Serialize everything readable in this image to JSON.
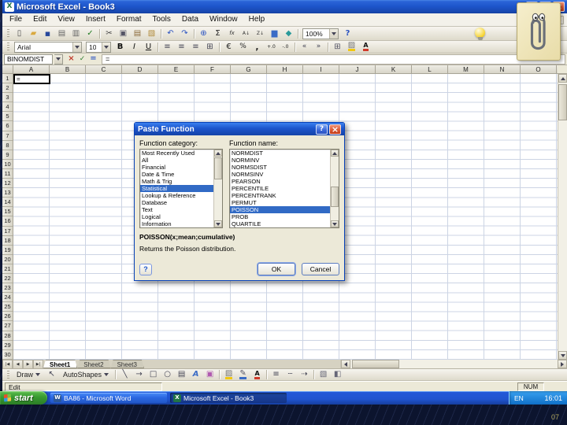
{
  "window": {
    "title": "Microsoft Excel - Book3",
    "app_icons": [
      "excel-app"
    ],
    "control_icons": [
      "minimize",
      "maximize",
      "close"
    ]
  },
  "menu": {
    "items": [
      "File",
      "Edit",
      "View",
      "Insert",
      "Format",
      "Tools",
      "Data",
      "Window",
      "Help"
    ],
    "window_icons": [
      "workbook-minimize",
      "workbook-restore",
      "workbook-close"
    ]
  },
  "standard_toolbar": {
    "icons_left": [
      "new-document",
      "open-folder",
      "save",
      "print",
      "print-preview",
      "spelling",
      "separator",
      "cut",
      "copy",
      "paste",
      "format-painter",
      "separator",
      "undo",
      "redo",
      "separator",
      "insert-hyperlink",
      "autosum",
      "paste-function",
      "sort-ascending",
      "sort-descending",
      "chart-wizard",
      "drawing",
      "separator"
    ],
    "zoom_value": "100%",
    "icons_right": [
      "help"
    ]
  },
  "formatting_toolbar": {
    "font_name": "Arial",
    "font_size": "10",
    "icons": [
      "bold",
      "italic",
      "underline",
      "separator",
      "align-left",
      "align-center",
      "align-right",
      "merge-and-center",
      "separator",
      "currency-style",
      "percent-style",
      "comma-style",
      "increase-decimal",
      "decrease-decimal",
      "separator",
      "decrease-indent",
      "increase-indent",
      "separator",
      "borders",
      "fill-color",
      "font-color"
    ]
  },
  "formula_bar": {
    "name_box": "BINOMDIST",
    "icons": [
      "cancel-formula",
      "enter-formula",
      "edit-formula"
    ],
    "content": "="
  },
  "grid": {
    "columns": [
      "A",
      "B",
      "C",
      "D",
      "E",
      "F",
      "G",
      "H",
      "I",
      "J",
      "K",
      "L",
      "M",
      "N",
      "O"
    ],
    "rows": [
      "1",
      "2",
      "3",
      "4",
      "5",
      "6",
      "7",
      "8",
      "9",
      "10",
      "11",
      "12",
      "13",
      "14",
      "15",
      "16",
      "17",
      "18",
      "19",
      "20",
      "21",
      "22",
      "23",
      "24",
      "25",
      "26",
      "27",
      "28",
      "29",
      "30"
    ],
    "active_cell": "A1",
    "active_cell_value": "="
  },
  "dialog": {
    "title": "Paste Function",
    "control_icons": [
      "dialog-help",
      "dialog-close"
    ],
    "category_label": "Function category:",
    "function_label": "Function name:",
    "categories": [
      "Most Recently Used",
      "All",
      "Financial",
      "Date & Time",
      "Math & Trig",
      "Statistical",
      "Lookup & Reference",
      "Database",
      "Text",
      "Logical",
      "Information"
    ],
    "selected_category": "Statistical",
    "functions": [
      "NORMDIST",
      "NORMINV",
      "NORMSDIST",
      "NORMSINV",
      "PEARSON",
      "PERCENTILE",
      "PERCENTRANK",
      "PERMUT",
      "POISSON",
      "PROB",
      "QUARTILE"
    ],
    "selected_function": "POISSON",
    "signature": "POISSON(x;mean;cumulative)",
    "description": "Returns the Poisson distribution.",
    "help_label": "?",
    "ok_label": "OK",
    "cancel_label": "Cancel"
  },
  "sheet_tabs": {
    "nav_icons": [
      "tab-first",
      "tab-prev",
      "tab-next",
      "tab-last"
    ],
    "tabs": [
      "Sheet1",
      "Sheet2",
      "Sheet3"
    ],
    "active": "Sheet1"
  },
  "drawing_toolbar": {
    "draw_label": "Draw",
    "autoshapes_label": "AutoShapes",
    "icons_pre": [
      "select-object"
    ],
    "icons_post": [
      "separator",
      "line",
      "arrow",
      "rectangle",
      "oval",
      "text-box",
      "wordart",
      "clip-art",
      "separator",
      "fill-color-draw",
      "line-color",
      "font-color-draw",
      "separator",
      "line-style",
      "dash-style",
      "arrow-style",
      "separator",
      "shadow",
      "three-d"
    ]
  },
  "status_bar": {
    "mode": "Edit",
    "num_lock": "NUM"
  },
  "taskbar": {
    "start_label": "start",
    "tasks": [
      {
        "label": "BA86 - Microsoft Word",
        "icons": [
          "word-app"
        ]
      },
      {
        "label": "Microsoft Excel - Book3",
        "icons": [
          "excel-app-small"
        ]
      }
    ],
    "tray": {
      "language": "EN",
      "time": "16:01"
    }
  },
  "desktop": {
    "page_number": "07"
  }
}
